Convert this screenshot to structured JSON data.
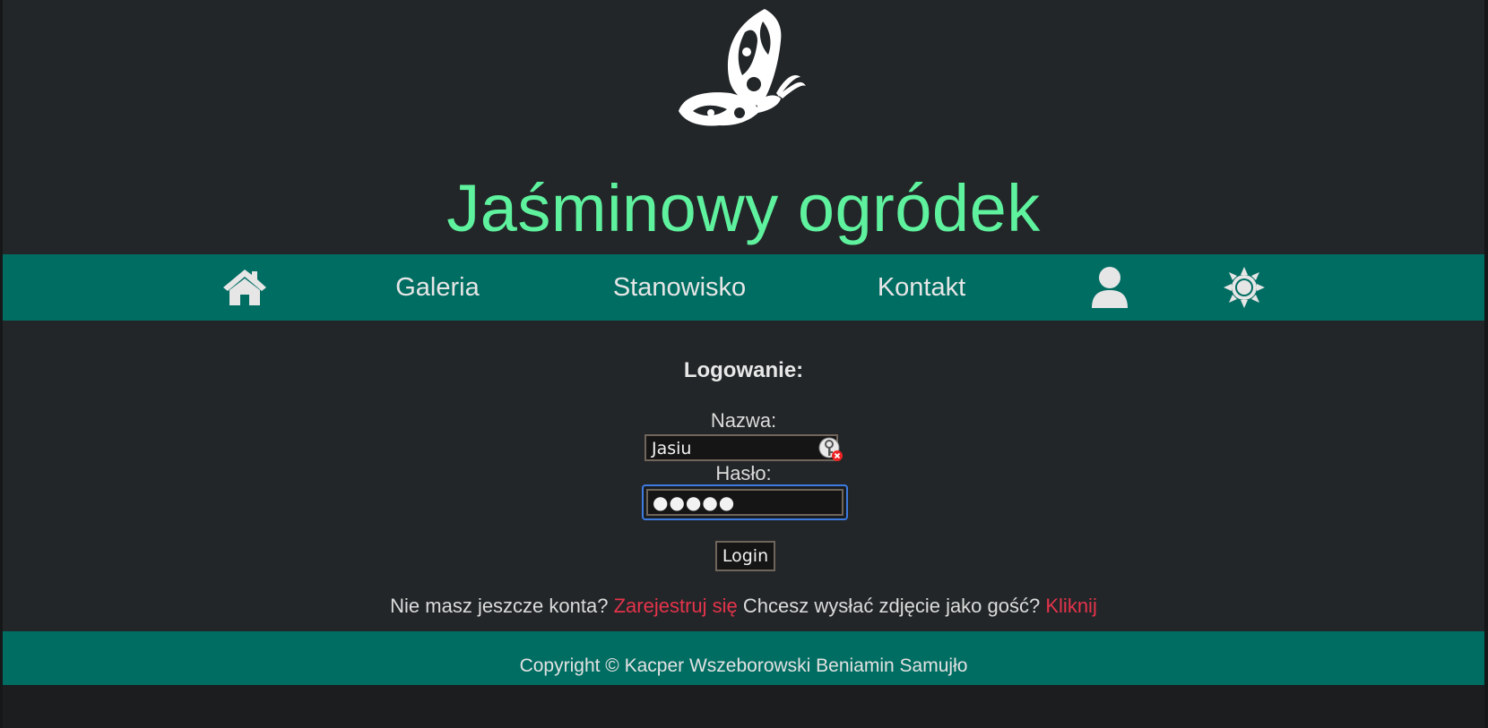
{
  "header": {
    "title": "Jaśminowy ogródek"
  },
  "nav": {
    "items": [
      {
        "label": "Galeria"
      },
      {
        "label": "Stanowisko"
      },
      {
        "label": "Kontakt"
      }
    ]
  },
  "login": {
    "title": "Logowanie:",
    "name_label": "Nazwa:",
    "name_value": "Jasiu",
    "password_label": "Hasło:",
    "password_value": "●●●●●",
    "button_label": "Login"
  },
  "links": {
    "no_account_text": "Nie masz jeszcze konta?",
    "register_link": "Zarejestruj się",
    "guest_text": "Chcesz wysłać zdjęcie jako gość?",
    "guest_link": "Kliknij"
  },
  "footer": {
    "copyright": "Copyright © Kacper Wszeborowski Beniamin Samujło"
  },
  "colors": {
    "accent_nav": "#006d62",
    "title_green": "#5ff29e",
    "link_red": "#e5334b",
    "background": "#222628"
  },
  "icons": [
    "butterfly-logo",
    "home-icon",
    "user-icon",
    "sun-settings-icon",
    "password-key-icon"
  ]
}
